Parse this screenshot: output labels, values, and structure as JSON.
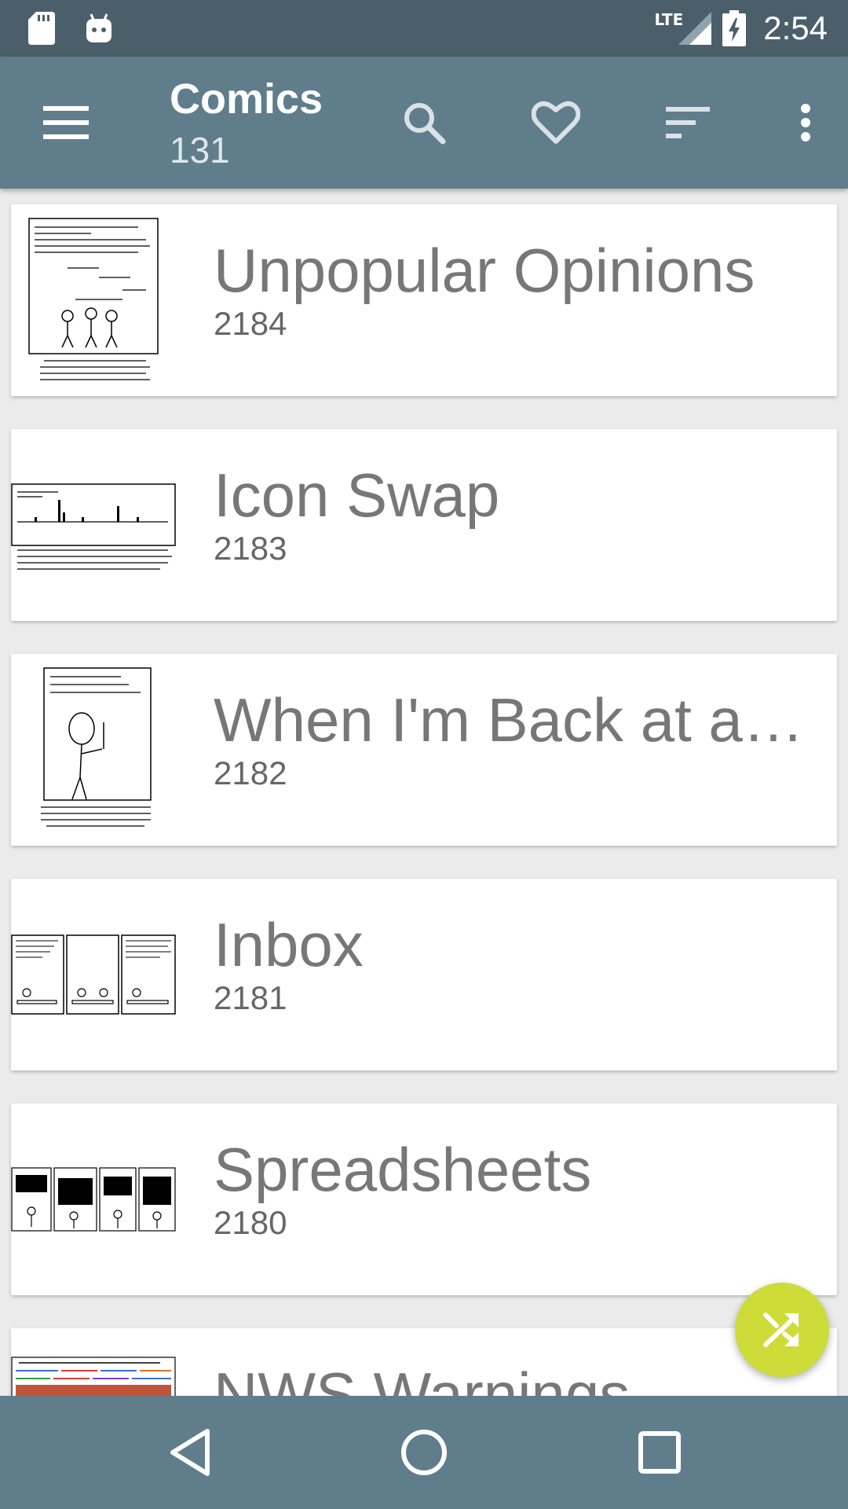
{
  "status_bar": {
    "time": "2:54",
    "network": "LTE",
    "icons": [
      "sd-card-icon",
      "android-icon",
      "signal-icon",
      "battery-charging-icon"
    ]
  },
  "app_bar": {
    "title": "Comics",
    "count": "131",
    "actions": [
      "menu-icon",
      "search-icon",
      "heart-icon",
      "sort-icon",
      "overflow-icon"
    ]
  },
  "comics": [
    {
      "title": "Unpopular Opinions",
      "number": "2184"
    },
    {
      "title": "Icon Swap",
      "number": "2183"
    },
    {
      "title": "When I'm Back at a Keyboard",
      "number": "2182"
    },
    {
      "title": "Inbox",
      "number": "2181"
    },
    {
      "title": "Spreadsheets",
      "number": "2180"
    },
    {
      "title": "NWS Warnings",
      "number": ""
    }
  ],
  "fab": {
    "icon": "shuffle-icon"
  },
  "colors": {
    "status_bar": "#4a5f6a",
    "app_bar": "#607d8b",
    "fab": "#cddc39",
    "background": "#ebebeb"
  }
}
